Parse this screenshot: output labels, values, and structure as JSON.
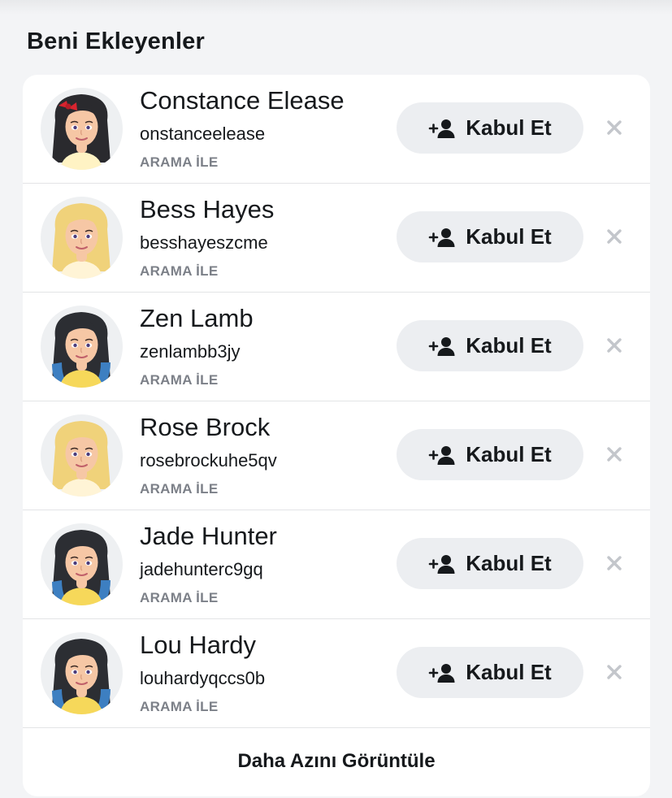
{
  "section": {
    "title": "Beni Ekleyenler"
  },
  "requests": [
    {
      "name": "Constance Elease",
      "username": "onstanceelease",
      "source": "ARAMA İLE",
      "accept_label": "Kabul Et",
      "avatar": "avatar-dark-hair-red-bow"
    },
    {
      "name": "Bess Hayes",
      "username": "besshayeszcme",
      "source": "ARAMA İLE",
      "accept_label": "Kabul Et",
      "avatar": "avatar-blonde-hair"
    },
    {
      "name": "Zen Lamb",
      "username": "zenlambb3jy",
      "source": "ARAMA İLE",
      "accept_label": "Kabul Et",
      "avatar": "avatar-dark-blue-hair"
    },
    {
      "name": "Rose Brock",
      "username": "rosebrockuhe5qv",
      "source": "ARAMA İLE",
      "accept_label": "Kabul Et",
      "avatar": "avatar-blonde-hair"
    },
    {
      "name": "Jade Hunter",
      "username": "jadehunterc9gq",
      "source": "ARAMA İLE",
      "accept_label": "Kabul Et",
      "avatar": "avatar-dark-blue-hair"
    },
    {
      "name": "Lou Hardy",
      "username": "louhardyqccs0b",
      "source": "ARAMA İLE",
      "accept_label": "Kabul Et",
      "avatar": "avatar-dark-blue-hair"
    }
  ],
  "footer": {
    "view_less_label": "Daha Azını Görüntüle"
  },
  "icons": {
    "accept": "add-friend-icon",
    "dismiss": "close-icon"
  },
  "colors": {
    "background": "#f3f4f6",
    "card": "#ffffff",
    "button": "#eceef1",
    "text": "#16191c",
    "muted": "#7c8088",
    "dismiss": "#c3c6cb"
  }
}
